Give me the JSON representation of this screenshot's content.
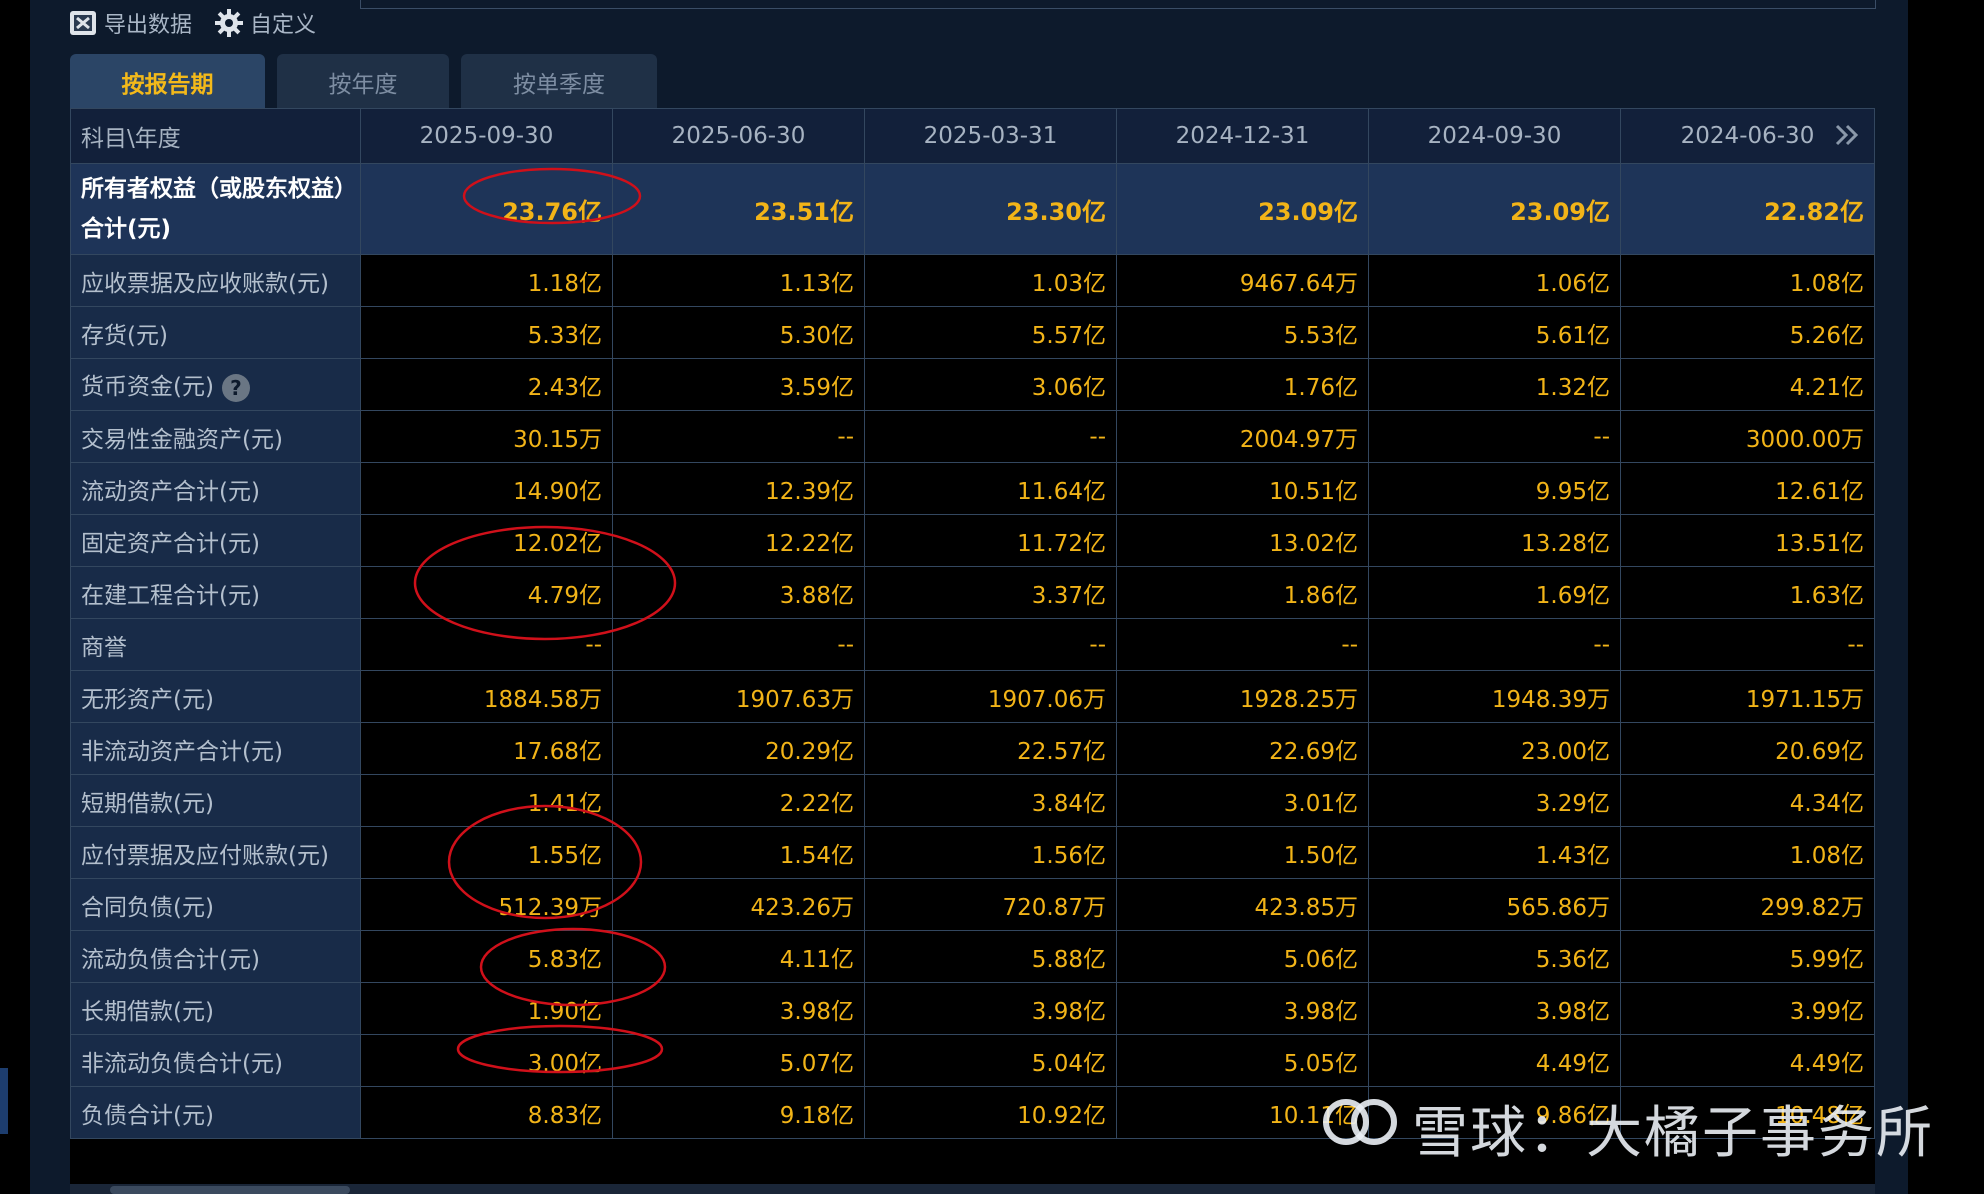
{
  "toolbar": {
    "export_label": "导出数据",
    "custom_label": "自定义"
  },
  "tabs": [
    {
      "label": "按报告期",
      "active": true
    },
    {
      "label": "按年度",
      "active": false
    },
    {
      "label": "按单季度",
      "active": false
    }
  ],
  "table": {
    "corner_label": "科目\\年度",
    "periods": [
      "2025-09-30",
      "2025-06-30",
      "2025-03-31",
      "2024-12-31",
      "2024-09-30",
      "2024-06-30"
    ],
    "rows": [
      {
        "label": "所有者权益（或股东权益）合计(元)",
        "values": [
          "23.76亿",
          "23.51亿",
          "23.30亿",
          "23.09亿",
          "23.09亿",
          "22.82亿"
        ]
      },
      {
        "label": "应收票据及应收账款(元)",
        "values": [
          "1.18亿",
          "1.13亿",
          "1.03亿",
          "9467.64万",
          "1.06亿",
          "1.08亿"
        ]
      },
      {
        "label": "存货(元)",
        "values": [
          "5.33亿",
          "5.30亿",
          "5.57亿",
          "5.53亿",
          "5.61亿",
          "5.26亿"
        ]
      },
      {
        "label": "货币资金(元)",
        "values": [
          "2.43亿",
          "3.59亿",
          "3.06亿",
          "1.76亿",
          "1.32亿",
          "4.21亿"
        ]
      },
      {
        "label": "交易性金融资产(元)",
        "values": [
          "30.15万",
          "--",
          "--",
          "2004.97万",
          "--",
          "3000.00万"
        ]
      },
      {
        "label": "流动资产合计(元)",
        "values": [
          "14.90亿",
          "12.39亿",
          "11.64亿",
          "10.51亿",
          "9.95亿",
          "12.61亿"
        ]
      },
      {
        "label": "固定资产合计(元)",
        "values": [
          "12.02亿",
          "12.22亿",
          "11.72亿",
          "13.02亿",
          "13.28亿",
          "13.51亿"
        ]
      },
      {
        "label": "在建工程合计(元)",
        "values": [
          "4.79亿",
          "3.88亿",
          "3.37亿",
          "1.86亿",
          "1.69亿",
          "1.63亿"
        ]
      },
      {
        "label": "商誉",
        "values": [
          "--",
          "--",
          "--",
          "--",
          "--",
          "--"
        ]
      },
      {
        "label": "无形资产(元)",
        "values": [
          "1884.58万",
          "1907.63万",
          "1907.06万",
          "1928.25万",
          "1948.39万",
          "1971.15万"
        ]
      },
      {
        "label": "非流动资产合计(元)",
        "values": [
          "17.68亿",
          "20.29亿",
          "22.57亿",
          "22.69亿",
          "23.00亿",
          "20.69亿"
        ]
      },
      {
        "label": "短期借款(元)",
        "values": [
          "1.41亿",
          "2.22亿",
          "3.84亿",
          "3.01亿",
          "3.29亿",
          "4.34亿"
        ]
      },
      {
        "label": "应付票据及应付账款(元)",
        "values": [
          "1.55亿",
          "1.54亿",
          "1.56亿",
          "1.50亿",
          "1.43亿",
          "1.08亿"
        ]
      },
      {
        "label": "合同负债(元)",
        "values": [
          "512.39万",
          "423.26万",
          "720.87万",
          "423.85万",
          "565.86万",
          "299.82万"
        ]
      },
      {
        "label": "流动负债合计(元)",
        "values": [
          "5.83亿",
          "4.11亿",
          "5.88亿",
          "5.06亿",
          "5.36亿",
          "5.99亿"
        ]
      },
      {
        "label": "长期借款(元)",
        "values": [
          "1.90亿",
          "3.98亿",
          "3.98亿",
          "3.98亿",
          "3.98亿",
          "3.99亿"
        ]
      },
      {
        "label": "非流动负债合计(元)",
        "values": [
          "3.00亿",
          "5.07亿",
          "5.04亿",
          "5.05亿",
          "4.49亿",
          "4.49亿"
        ]
      },
      {
        "label": "负债合计(元)",
        "values": [
          "8.83亿",
          "9.18亿",
          "10.92亿",
          "10.11亿",
          "9.86亿",
          "10.48亿"
        ]
      }
    ]
  },
  "watermark": {
    "text": "雪球：大橘子事务所"
  },
  "colors": {
    "value": "#f2b418",
    "annotation": "#d0101a",
    "header_bg": "#12203a",
    "label_bg": "#182b48"
  },
  "icons": [
    "excel-icon",
    "gear-icon",
    "question-icon",
    "double-chevron-right-icon",
    "snowball-logo-icon"
  ]
}
